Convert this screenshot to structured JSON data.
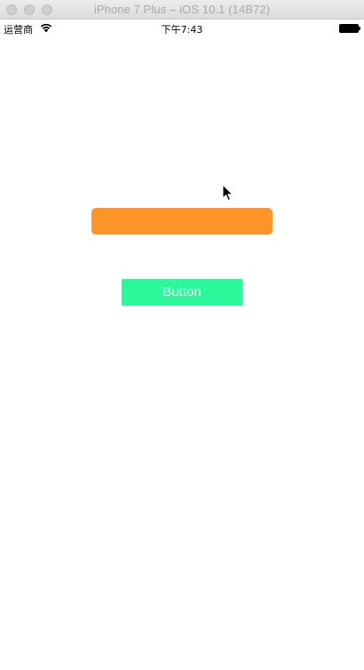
{
  "window": {
    "title": "iPhone 7 Plus – iOS 10.1 (14B72)"
  },
  "status_bar": {
    "carrier": "运营商",
    "time": "下午7:43",
    "wifi_icon": "wifi-icon",
    "battery_icon": "battery-icon"
  },
  "content": {
    "orange_bar_color": "#ff942a",
    "button_label": "Button",
    "button_color": "#2bf79b"
  }
}
